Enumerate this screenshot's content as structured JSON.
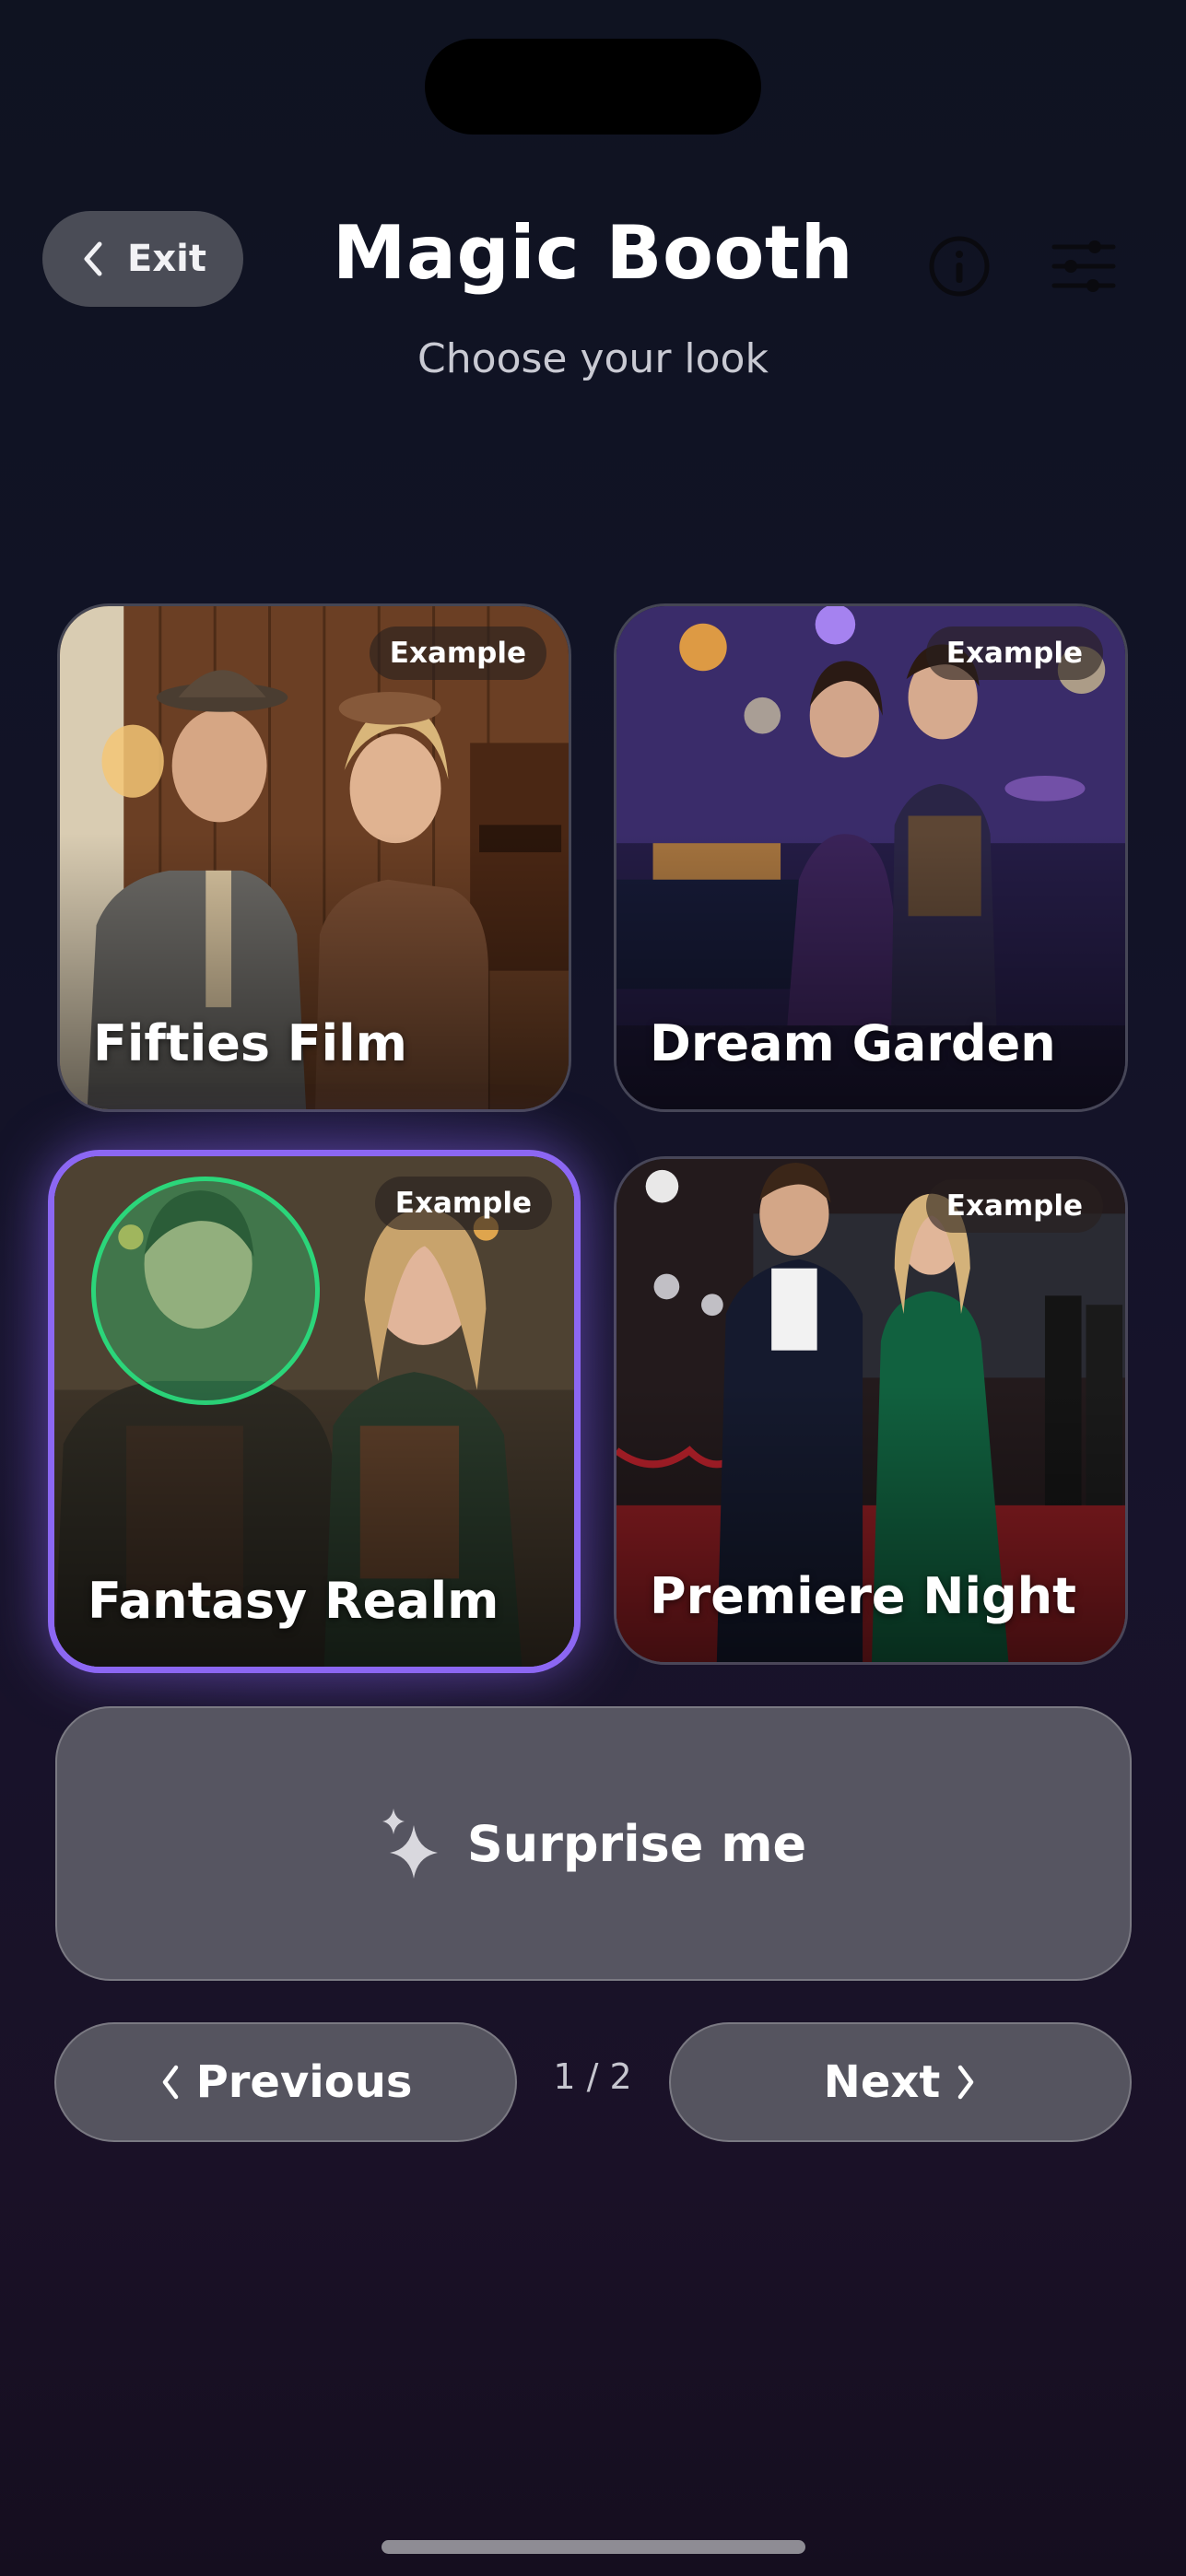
{
  "header": {
    "exit_label": "Exit",
    "title": "Magic Booth",
    "subtitle": "Choose your look"
  },
  "looks": [
    {
      "name": "Fifties Film",
      "badge": "Example",
      "selected": false
    },
    {
      "name": "Dream Garden",
      "badge": "Example",
      "selected": false
    },
    {
      "name": "Fantasy Realm",
      "badge": "Example",
      "selected": true
    },
    {
      "name": "Premiere Night",
      "badge": "Example",
      "selected": false
    }
  ],
  "surprise": {
    "label": "Surprise me",
    "icon": "sparkle-icon"
  },
  "pagination": {
    "previous_label": "Previous",
    "next_label": "Next",
    "indicator": "1 / 2"
  },
  "icons": {
    "exit": "chevron-left-icon",
    "info": "info-icon",
    "settings": "sliders-icon",
    "prev": "chevron-left-icon",
    "next": "chevron-right-icon"
  },
  "colors": {
    "selection_border": "#8c67f3",
    "face_marker": "#2bd67a",
    "button_fill": "#565561"
  }
}
